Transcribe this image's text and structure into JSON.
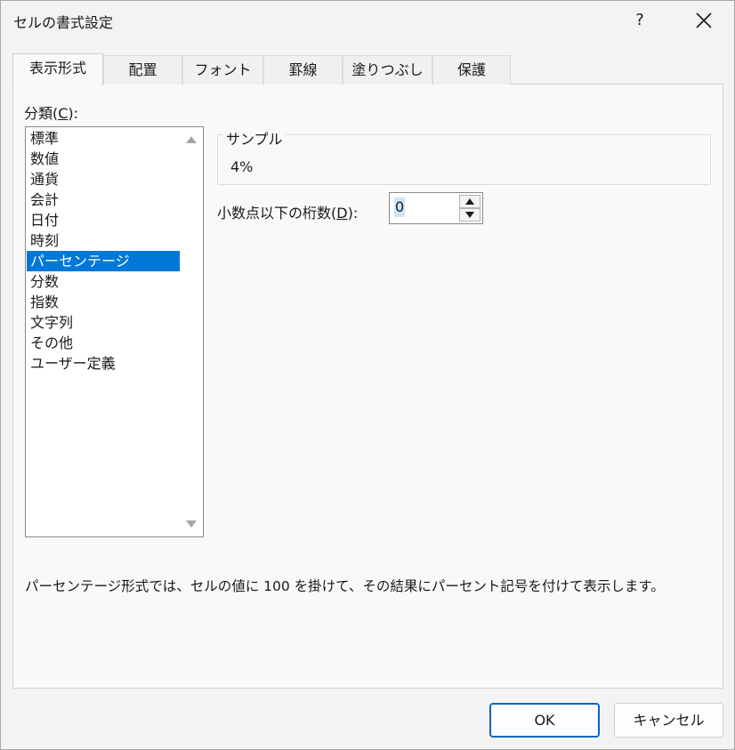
{
  "window": {
    "title": "セルの書式設定",
    "help_label": "?"
  },
  "tabs": [
    {
      "label": "表示形式",
      "active": true
    },
    {
      "label": "配置"
    },
    {
      "label": "フォント"
    },
    {
      "label": "罫線"
    },
    {
      "label": "塗りつぶし"
    },
    {
      "label": "保護"
    }
  ],
  "category": {
    "label_prefix": "分類(",
    "label_key": "C",
    "label_suffix": "):",
    "items": [
      "標準",
      "数値",
      "通貨",
      "会計",
      "日付",
      "時刻",
      "パーセンテージ",
      "分数",
      "指数",
      "文字列",
      "その他",
      "ユーザー定義"
    ],
    "selected": "パーセンテージ"
  },
  "sample": {
    "title": "サンプル",
    "value": "4%"
  },
  "decimals": {
    "label_prefix": "小数点以下の桁数(",
    "label_key": "D",
    "label_suffix": "):",
    "value": "0"
  },
  "description": "パーセンテージ形式では、セルの値に 100 を掛けて、その結果にパーセント記号を付けて表示します。",
  "buttons": {
    "ok": "OK",
    "cancel": "キャンセル"
  },
  "colors": {
    "selection": "#0078d7",
    "ok_border": "#0067c0"
  }
}
